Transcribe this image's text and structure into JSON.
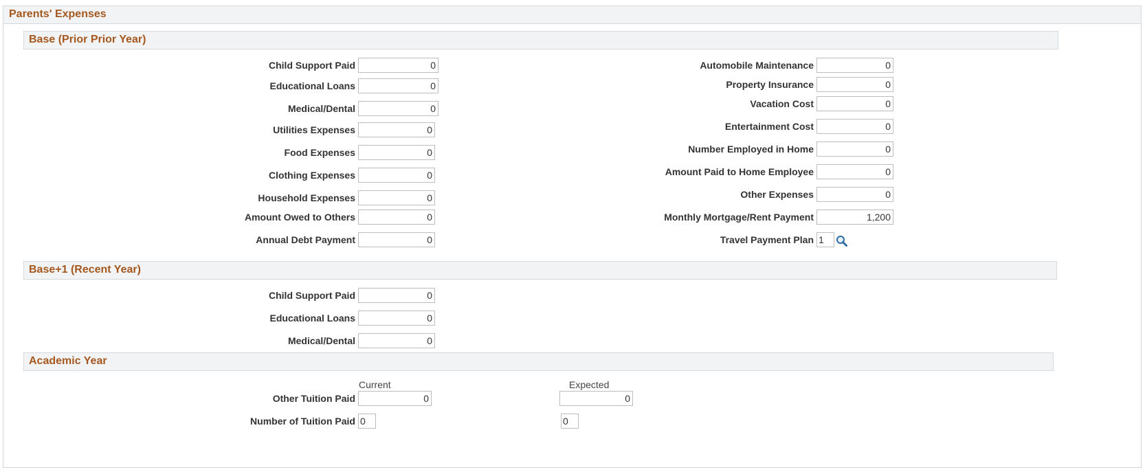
{
  "panel": {
    "title": "Parents' Expenses"
  },
  "base": {
    "title": "Base (Prior Prior Year)",
    "left": [
      {
        "label": "Child Support Paid",
        "value": "0"
      },
      {
        "label": "Educational Loans",
        "value": "0"
      },
      {
        "label": "Medical/Dental",
        "value": "0"
      },
      {
        "label": "Utilities Expenses",
        "value": "0"
      },
      {
        "label": "Food Expenses",
        "value": "0"
      },
      {
        "label": "Clothing Expenses",
        "value": "0"
      },
      {
        "label": "Household Expenses",
        "value": "0"
      },
      {
        "label": "Amount Owed to Others",
        "value": "0"
      },
      {
        "label": "Annual Debt Payment",
        "value": "0"
      }
    ],
    "right": [
      {
        "label": "Automobile Maintenance",
        "value": "0"
      },
      {
        "label": "Property Insurance",
        "value": "0"
      },
      {
        "label": "Vacation Cost",
        "value": "0"
      },
      {
        "label": "Entertainment Cost",
        "value": "0"
      },
      {
        "label": "Number Employed in Home",
        "value": "0"
      },
      {
        "label": "Amount Paid to Home Employee",
        "value": "0"
      },
      {
        "label": "Other Expenses",
        "value": "0"
      },
      {
        "label": "Monthly Mortgage/Rent Payment",
        "value": "1,200"
      }
    ],
    "travel_plan": {
      "label": "Travel Payment Plan",
      "value": "1",
      "lookup_icon": "magnifier-icon"
    }
  },
  "recent": {
    "title": "Base+1 (Recent Year)",
    "fields": [
      {
        "label": "Child Support Paid",
        "value": "0"
      },
      {
        "label": "Educational Loans",
        "value": "0"
      },
      {
        "label": "Medical/Dental",
        "value": "0"
      }
    ]
  },
  "academic": {
    "title": "Academic Year",
    "col_current": "Current",
    "col_expected": "Expected",
    "other_tuition": {
      "label": "Other Tuition Paid",
      "current": "0",
      "expected": "0"
    },
    "num_tuition": {
      "label": "Number of Tuition Paid",
      "current": "0",
      "expected": "0"
    }
  },
  "colors": {
    "section_title": "#a4581f",
    "header_bg": "#f1f3f4",
    "border": "#d6dadd"
  }
}
